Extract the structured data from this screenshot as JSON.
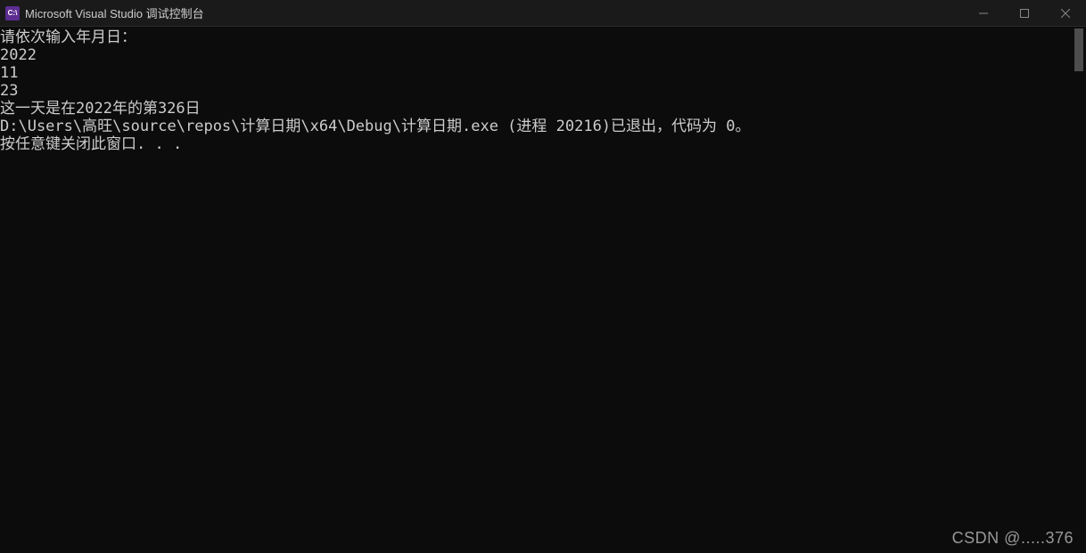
{
  "titlebar": {
    "icon_label": "C:\\",
    "title": "Microsoft Visual Studio 调试控制台"
  },
  "console": {
    "lines": [
      "请依次输入年月日：",
      "2022",
      "11",
      "23",
      "这一天是在2022年的第326日",
      "",
      "D:\\Users\\高旺\\source\\repos\\计算日期\\x64\\Debug\\计算日期.exe (进程 20216)已退出，代码为 0。",
      "按任意键关闭此窗口. . ."
    ]
  },
  "watermark": {
    "text": "CSDN @.....376"
  }
}
